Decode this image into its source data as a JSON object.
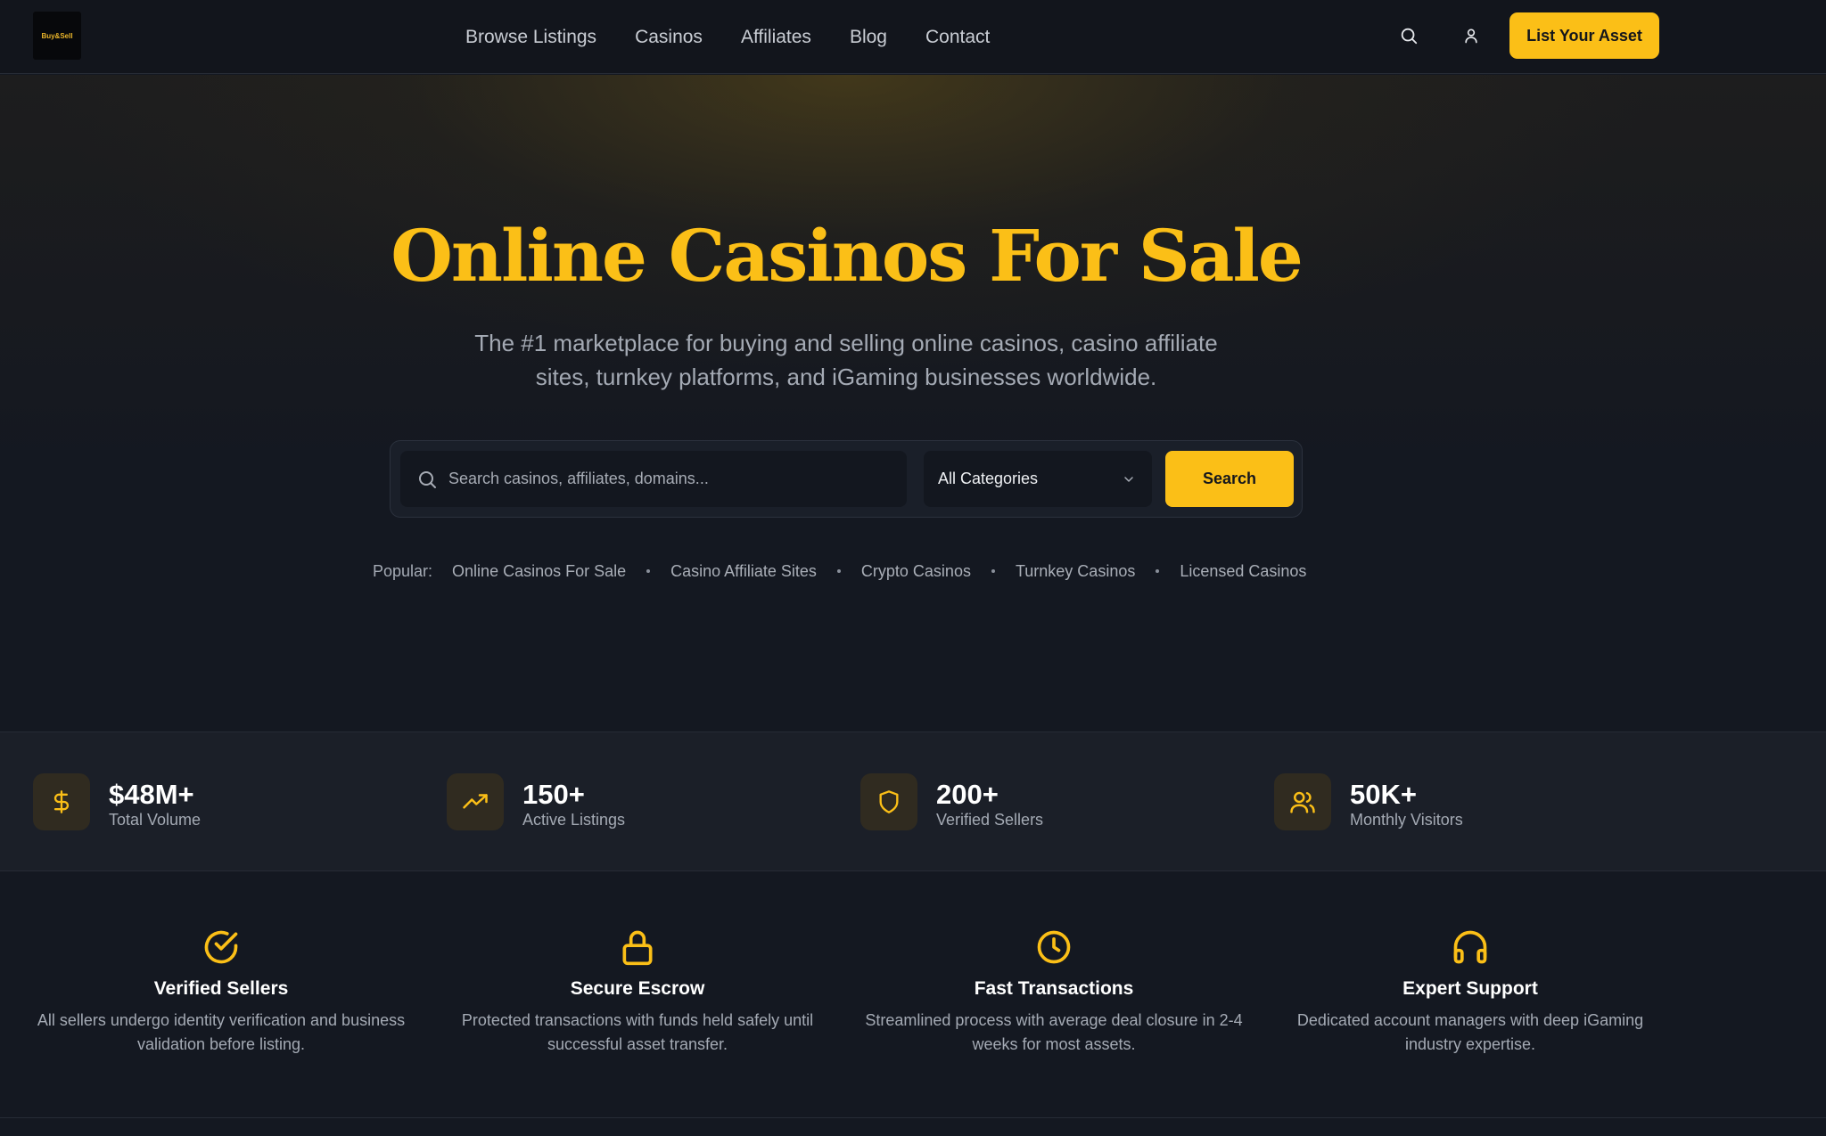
{
  "nav": {
    "logo_text": "Buy&Sell",
    "links": [
      "Browse Listings",
      "Casinos",
      "Affiliates",
      "Blog",
      "Contact"
    ],
    "icons": [
      "search-icon",
      "user-icon"
    ],
    "cta_label": "List Your Asset"
  },
  "hero": {
    "title": "Online Casinos For Sale",
    "subtitle": "The #1 marketplace for buying and selling online casinos, casino affiliate sites, turnkey platforms, and iGaming businesses worldwide.",
    "search": {
      "placeholder": "Search casinos, affiliates, domains...",
      "value": "",
      "category_selected": "All Categories",
      "button_label": "Search"
    },
    "popular_label": "Popular:",
    "popular_links": [
      "Online Casinos For Sale",
      "Casino Affiliate Sites",
      "Crypto Casinos",
      "Turnkey Casinos",
      "Licensed Casinos"
    ]
  },
  "stats": [
    {
      "icon": "dollar-icon",
      "value": "$48M+",
      "label": "Total Volume"
    },
    {
      "icon": "trending-up-icon",
      "value": "150+",
      "label": "Active Listings"
    },
    {
      "icon": "shield-icon",
      "value": "200+",
      "label": "Verified Sellers"
    },
    {
      "icon": "users-icon",
      "value": "50K+",
      "label": "Monthly Visitors"
    }
  ],
  "features": [
    {
      "icon": "check-circle-icon",
      "title": "Verified Sellers",
      "desc": "All sellers undergo identity verification and business validation before listing."
    },
    {
      "icon": "lock-icon",
      "title": "Secure Escrow",
      "desc": "Protected transactions with funds held safely until successful asset transfer."
    },
    {
      "icon": "clock-icon",
      "title": "Fast Transactions",
      "desc": "Streamlined process with average deal closure in 2-4 weeks for most assets."
    },
    {
      "icon": "headphones-icon",
      "title": "Expert Support",
      "desc": "Dedicated account managers with deep iGaming industry expertise."
    }
  ],
  "colors": {
    "accent": "#fbbf17",
    "background": "#141821",
    "nav_background": "#12151c",
    "stats_background": "#1b1f28",
    "muted_text": "#a4aab4"
  }
}
